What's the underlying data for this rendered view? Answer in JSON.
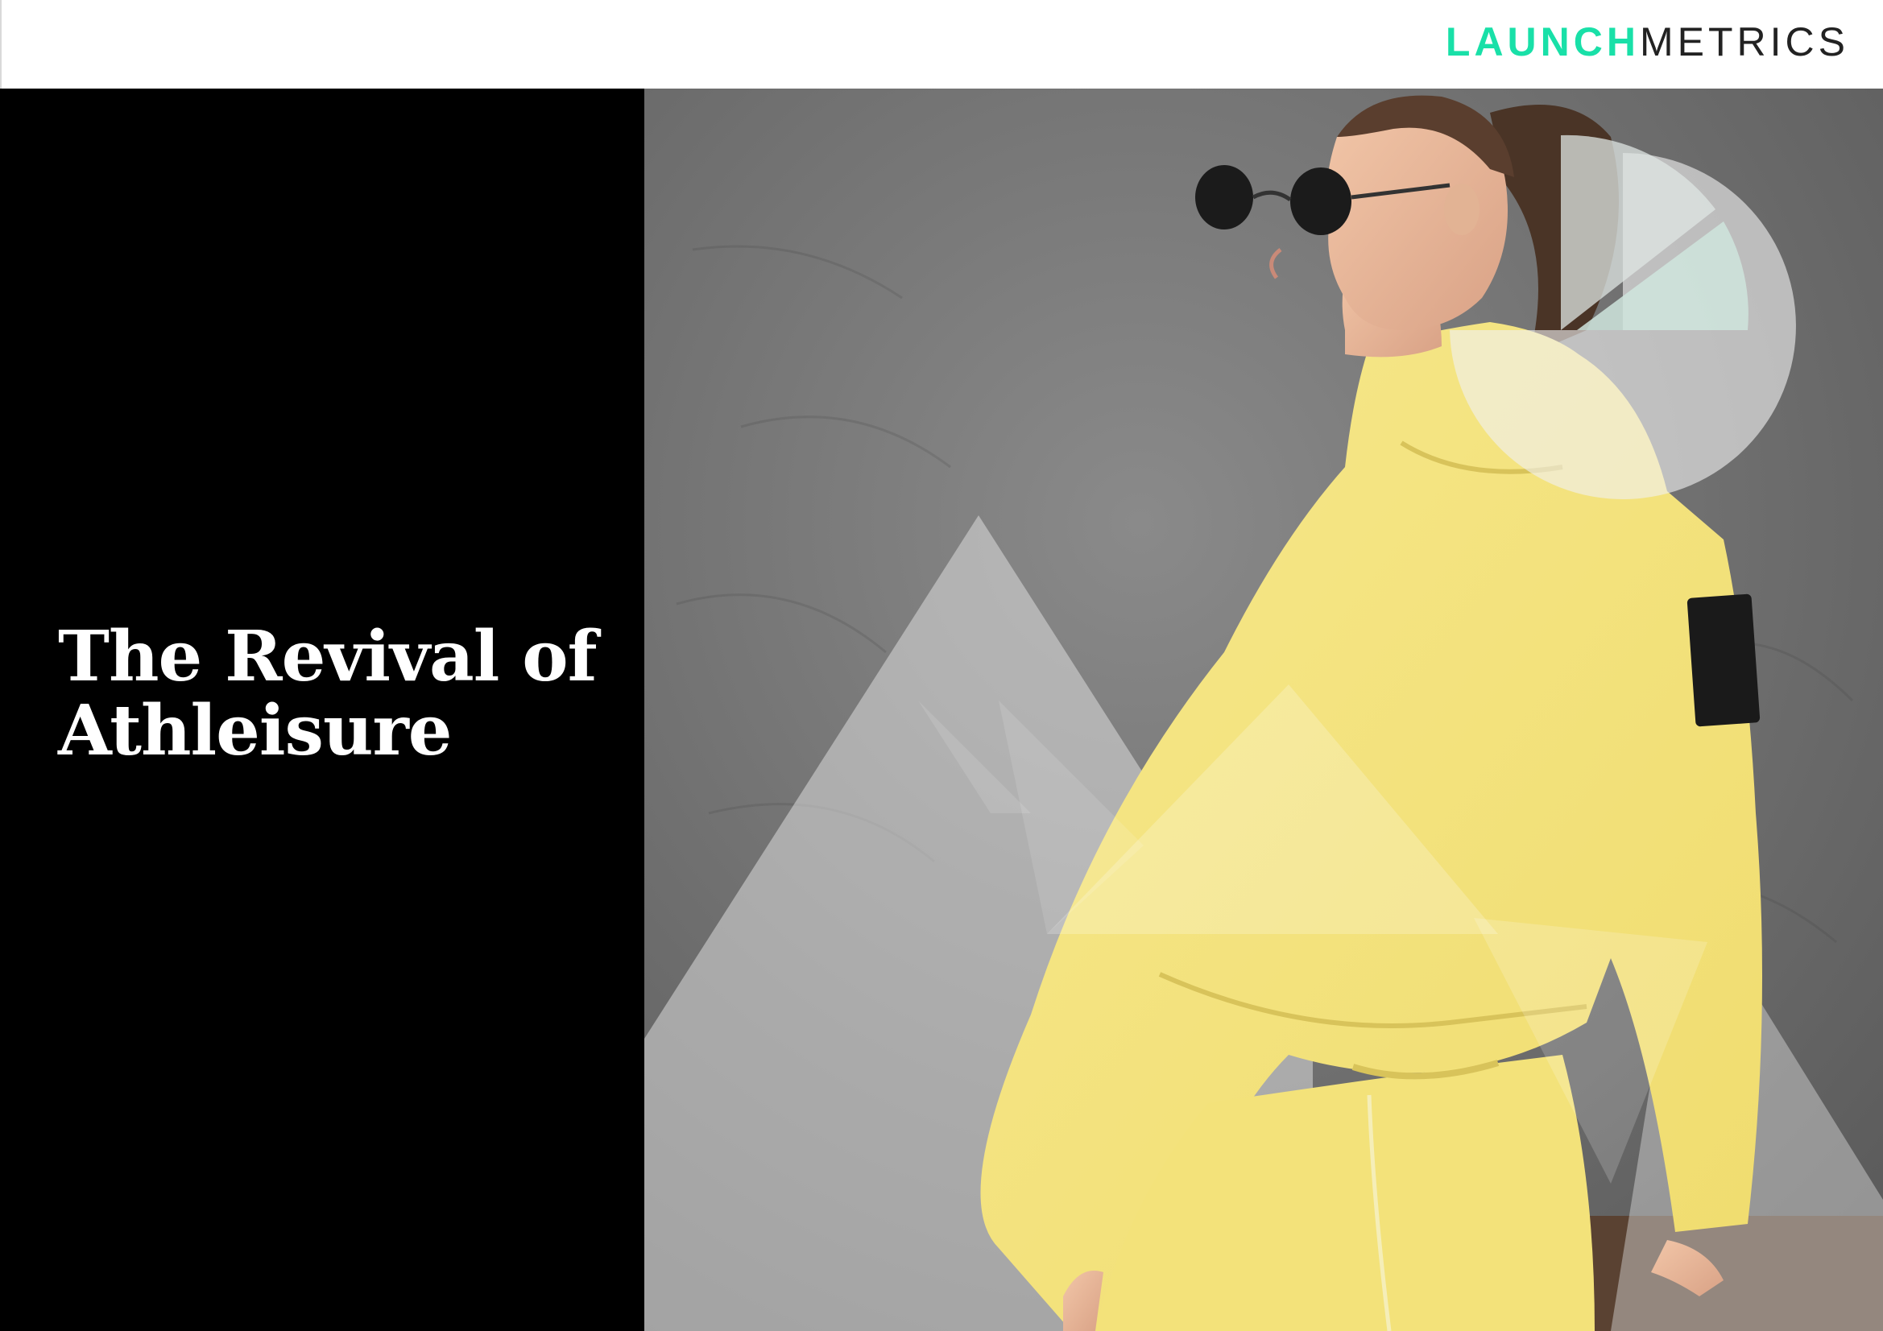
{
  "header": {
    "logo_primary": "LAUNCH",
    "logo_secondary": "METRICS",
    "logo_accent_color": "#19e0a8"
  },
  "cover": {
    "title_line1": "The Revival of",
    "title_line2": "Athleisure"
  },
  "photo": {
    "icon": "fashion-model-photo",
    "overlay_icons": [
      "pie-chart-icon",
      "triangle-shapes"
    ]
  }
}
